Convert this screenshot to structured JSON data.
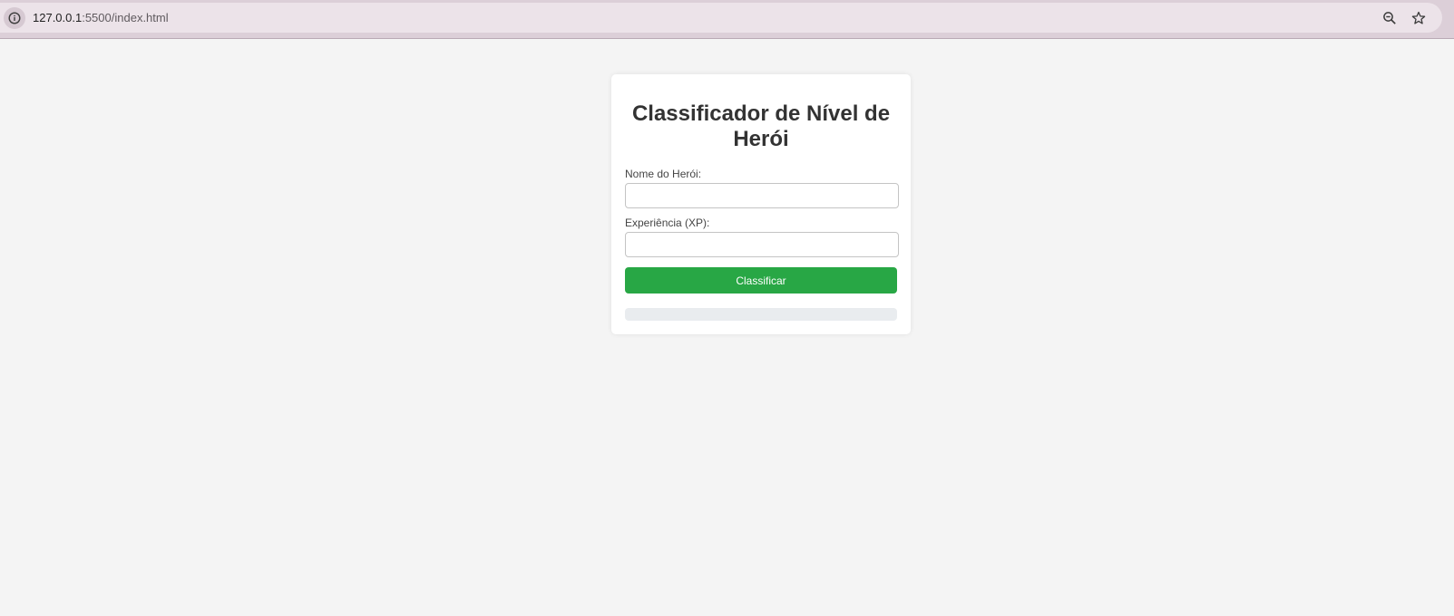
{
  "browser": {
    "url_host": "127.0.0.1",
    "url_path": ":5500/index.html"
  },
  "form": {
    "title": "Classificador de Nível de Herói",
    "name_label": "Nome do Herói:",
    "name_value": "",
    "xp_label": "Experiência (XP):",
    "xp_value": "",
    "submit_label": "Classificar",
    "result_text": ""
  },
  "colors": {
    "accent": "#28a745",
    "page_background": "#f4f4f4",
    "result_background": "#e9ecef"
  },
  "icons": {
    "site_info": "info-icon",
    "zoom": "zoom-out-icon",
    "bookmark": "star-icon"
  }
}
